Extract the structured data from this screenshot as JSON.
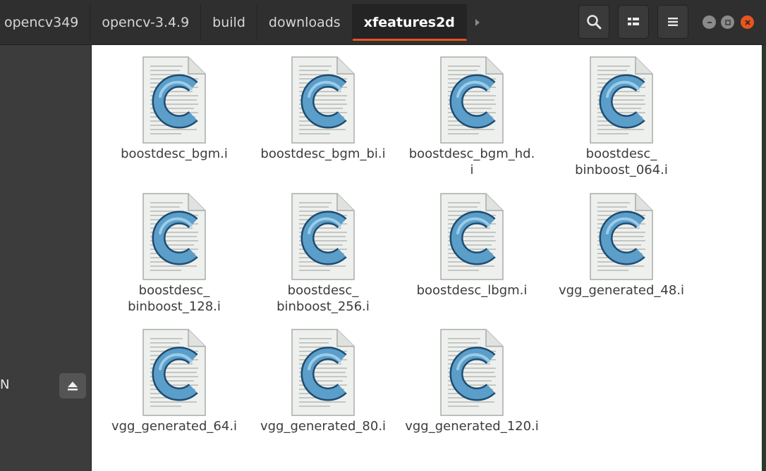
{
  "breadcrumbs": [
    "opencv349",
    "opencv-3.4.9",
    "build",
    "downloads",
    "xfeatures2d"
  ],
  "toolbar": {
    "search_icon": "search-icon",
    "view_icon": "view-toggle-icon",
    "menu_icon": "hamburger-menu-icon"
  },
  "window_colors": {
    "minimize": "#8a8a8a",
    "maximize": "#8a8a8a",
    "close": "#e95420"
  },
  "sidebar": {
    "partial_label": "N",
    "eject_icon": "eject-icon"
  },
  "files": [
    {
      "name": "boostdesc_bgm.i",
      "icon": "c-source-file-icon"
    },
    {
      "name": "boostdesc_bgm_bi.i",
      "icon": "c-source-file-icon"
    },
    {
      "name": "boostdesc_bgm_hd.\ni",
      "icon": "c-source-file-icon"
    },
    {
      "name": "boostdesc_\nbinboost_064.i",
      "icon": "c-source-file-icon"
    },
    {
      "name": "boostdesc_\nbinboost_128.i",
      "icon": "c-source-file-icon"
    },
    {
      "name": "boostdesc_\nbinboost_256.i",
      "icon": "c-source-file-icon"
    },
    {
      "name": "boostdesc_lbgm.i",
      "icon": "c-source-file-icon"
    },
    {
      "name": "vgg_generated_48.i",
      "icon": "c-source-file-icon"
    },
    {
      "name": "vgg_generated_64.i",
      "icon": "c-source-file-icon"
    },
    {
      "name": "vgg_generated_80.i",
      "icon": "c-source-file-icon"
    },
    {
      "name": "vgg_generated_120.i",
      "icon": "c-source-file-icon"
    }
  ]
}
